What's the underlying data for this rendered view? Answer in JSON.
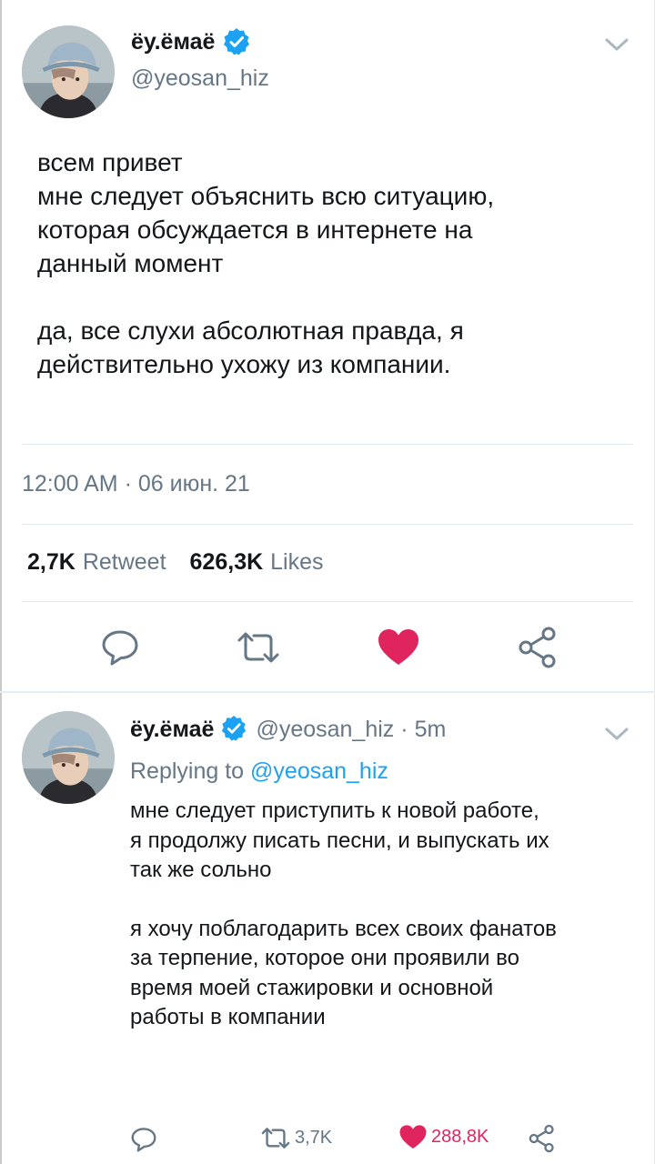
{
  "main_tweet": {
    "display_name": "ёу.ёмаё",
    "handle": "@yeosan_hiz",
    "text_para1": "всем привет\nмне следует объяснить всю ситуацию,\nкоторая обсуждается в интернете на\nданный момент",
    "text_para2": "да, все слухи абсолютная правда, я\nдействительно ухожу из компании.",
    "timestamp": "12:00 AM · 06 июн. 21",
    "retweet_count": "2,7K",
    "retweet_label": "Retweet",
    "likes_count": "626,3K",
    "likes_label": "Likes",
    "liked": true
  },
  "reply_tweet": {
    "display_name": "ёу.ёмаё",
    "handle": "@yeosan_hiz",
    "separator": "·",
    "time": "5m",
    "replying_label": "Replying to",
    "replying_to": "@yeosan_hiz",
    "text_para1": "мне следует приступить к новой работе,\nя продолжу писать песни, и выпускать их\nтак же сольно",
    "text_para2": "я хочу поблагодарить всех своих фанатов\nза терпение, которое они проявили во\nвремя моей стажировки и основной\nработы в компании",
    "retweet_count": "3,7K",
    "like_count": "288,8K",
    "liked": true
  },
  "colors": {
    "accent": "#1da1f2",
    "like": "#e0245e",
    "secondary_text": "#657786",
    "divider": "#e1e8ed"
  },
  "icons": {
    "verified": "verified-badge-icon",
    "more": "chevron-down-icon",
    "reply": "reply-bubble-icon",
    "retweet": "retweet-icon",
    "like": "heart-icon",
    "share": "share-icon"
  }
}
